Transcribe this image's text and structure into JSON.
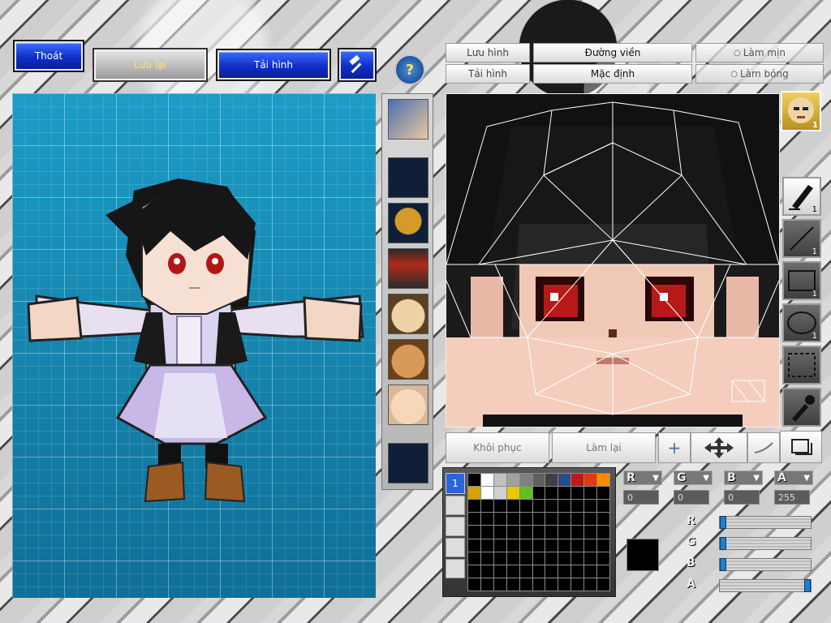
{
  "top_bar": {
    "exit_label": "Thoát",
    "save_label": "Lưu lại",
    "load_label": "Tải hình",
    "tool_icon": "hammer-icon",
    "help_icon": "question-icon"
  },
  "texture_tabs": {
    "save_image": "Lưu hình",
    "load_image": "Tải hình",
    "outline": "Đường viền",
    "default": "Mặc định",
    "smooth": "Làm mịn",
    "shade": "Làm bóng"
  },
  "texture_slots": [
    {
      "name": "face-portrait"
    },
    {
      "name": "empty"
    },
    {
      "name": "straw-hat"
    },
    {
      "name": "red-armor"
    },
    {
      "name": "face-blue-eyes"
    },
    {
      "name": "face-tan"
    },
    {
      "name": "face-light"
    },
    {
      "name": "empty"
    }
  ],
  "tools": {
    "portrait_badge": "1",
    "pen_count": "1",
    "line_count": "1",
    "rect_count": "1",
    "ellipse_count": "1"
  },
  "edit_bar": {
    "undo_label": "Khôi phục",
    "redo_label": "Làm lại"
  },
  "color": {
    "r_label": "R",
    "g_label": "G",
    "b_label": "B",
    "a_label": "A",
    "r_value": "0",
    "g_value": "0",
    "b_value": "0",
    "a_value": "255",
    "r_fraction": 0,
    "g_fraction": 0,
    "b_fraction": 0,
    "a_fraction": 1,
    "current": "#000000"
  },
  "palette": [
    "#000000",
    "#ffffff",
    "#c0c0c0",
    "#a0a0a0",
    "#808080",
    "#606060",
    "#404040",
    "#2a4a8a",
    "#c01818",
    "#e03a10",
    "#ff8a00",
    "#d8a000",
    "#ffffff",
    "#d0d0d0",
    "#e8c800",
    "#60c020"
  ],
  "palette_tab": "1"
}
